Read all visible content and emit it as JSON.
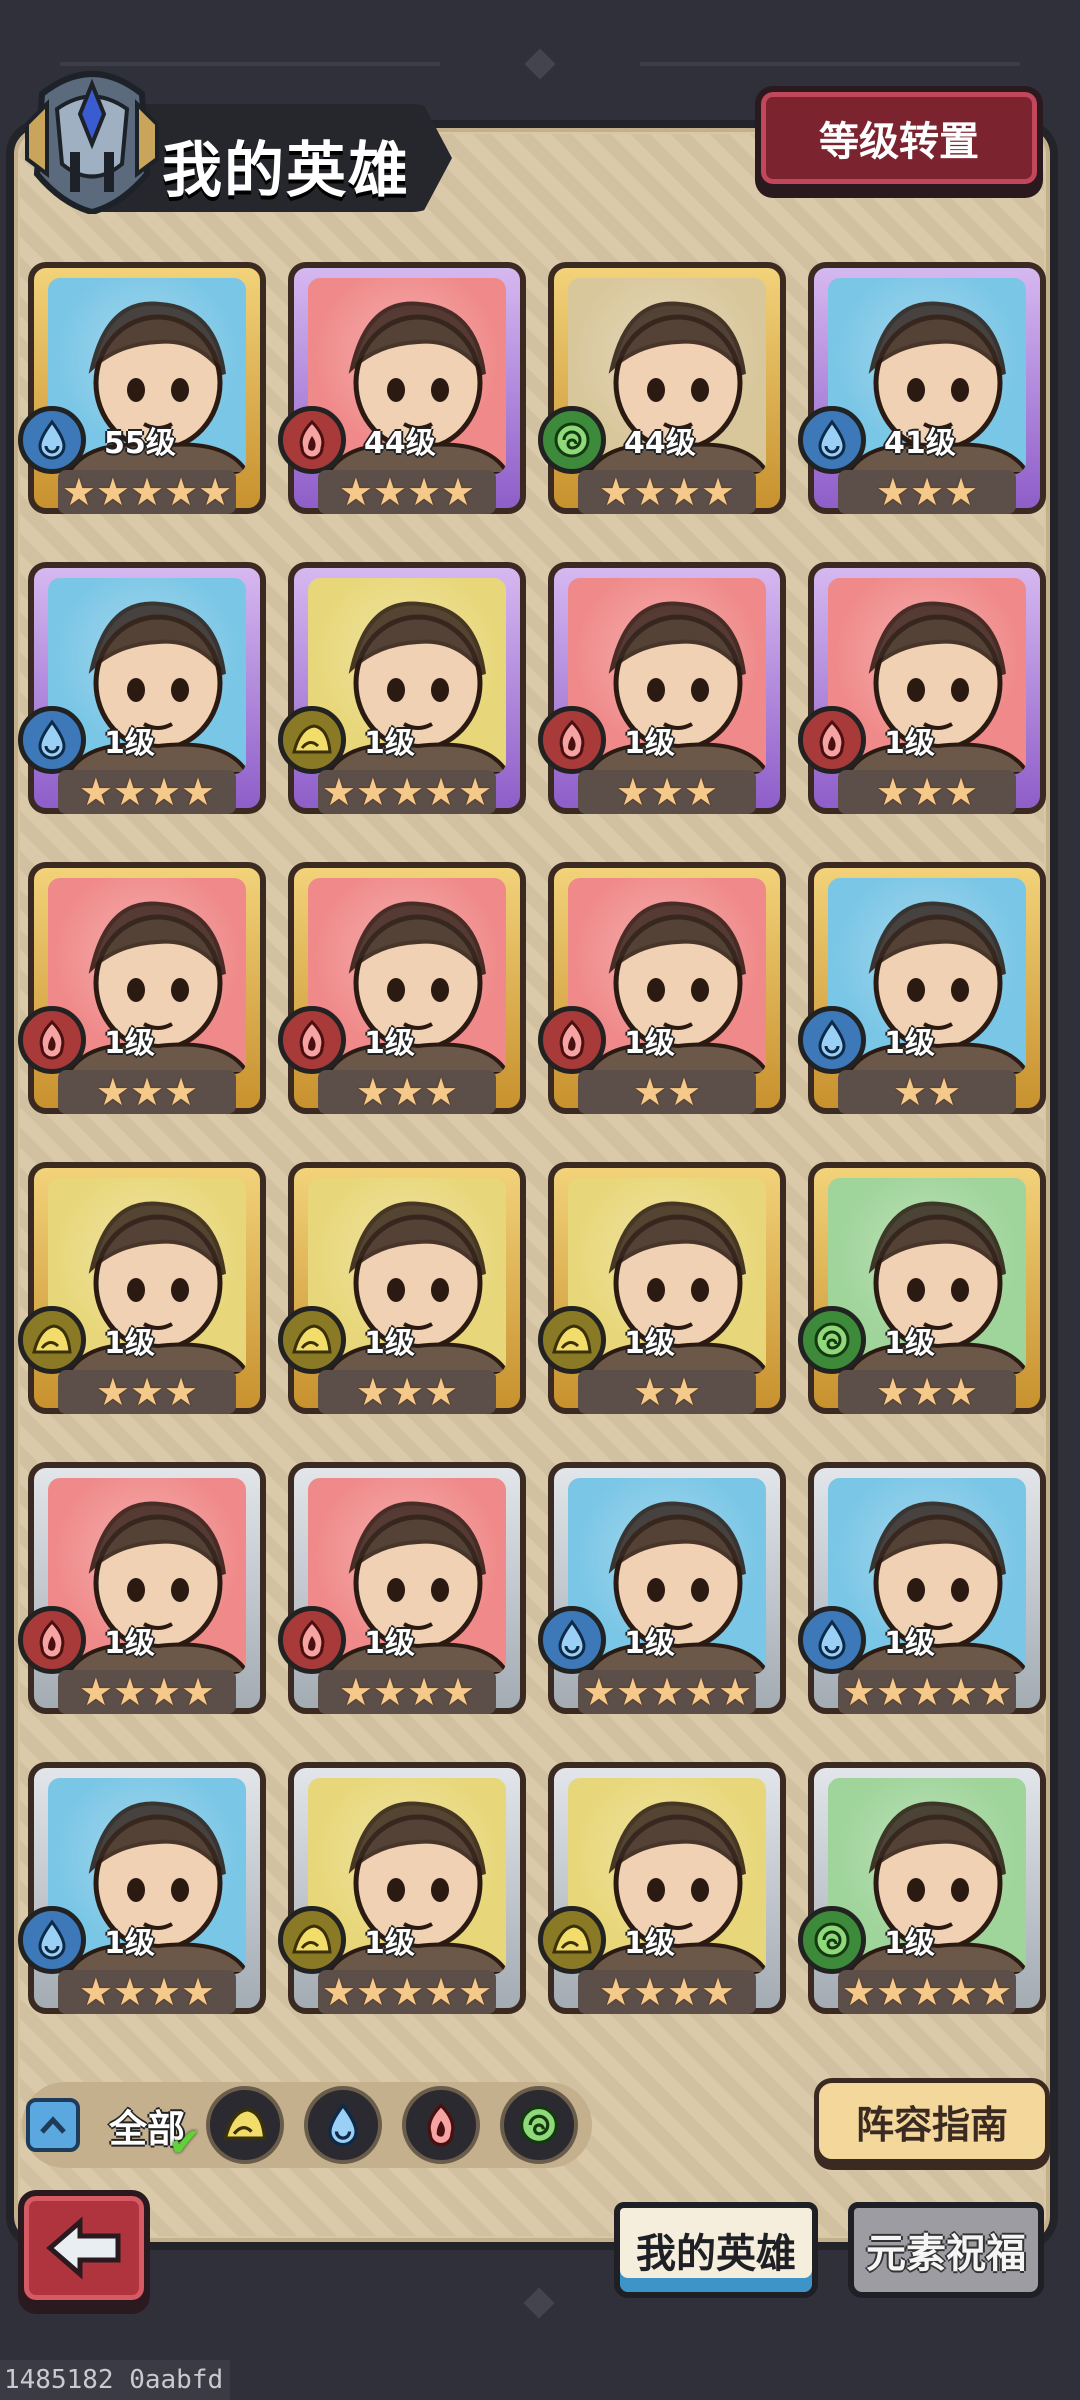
{
  "header": {
    "title": "我的英雄",
    "transfer_button": "等级转置"
  },
  "heroes": [
    {
      "level": "55级",
      "element": "water",
      "stars": "★★★★★",
      "frame": "gold",
      "bg": "#7ac6e6"
    },
    {
      "level": "44级",
      "element": "fire",
      "stars": "★★★★",
      "frame": "purple",
      "bg": "#f08a8a"
    },
    {
      "level": "44级",
      "element": "wind",
      "stars": "★★★★",
      "frame": "gold",
      "bg": "#d9c79c"
    },
    {
      "level": "41级",
      "element": "water",
      "stars": "★★★",
      "frame": "purple",
      "bg": "#7ac6e6"
    },
    {
      "level": "1级",
      "element": "water",
      "stars": "★★★★",
      "frame": "purple",
      "bg": "#7ac6e6"
    },
    {
      "level": "1级",
      "element": "earth",
      "stars": "★★★★★",
      "frame": "purple",
      "bg": "#e8d77a"
    },
    {
      "level": "1级",
      "element": "fire",
      "stars": "★★★",
      "frame": "purple",
      "bg": "#f08a8a"
    },
    {
      "level": "1级",
      "element": "fire",
      "stars": "★★★",
      "frame": "purple",
      "bg": "#f08a8a"
    },
    {
      "level": "1级",
      "element": "fire",
      "stars": "★★★",
      "frame": "gold",
      "bg": "#f08a8a"
    },
    {
      "level": "1级",
      "element": "fire",
      "stars": "★★★",
      "frame": "gold",
      "bg": "#f08a8a"
    },
    {
      "level": "1级",
      "element": "fire",
      "stars": "★★",
      "frame": "gold",
      "bg": "#f08a8a"
    },
    {
      "level": "1级",
      "element": "water",
      "stars": "★★",
      "frame": "gold",
      "bg": "#7ac6e6"
    },
    {
      "level": "1级",
      "element": "earth",
      "stars": "★★★",
      "frame": "gold",
      "bg": "#e8d77a"
    },
    {
      "level": "1级",
      "element": "earth",
      "stars": "★★★",
      "frame": "gold",
      "bg": "#e8d77a"
    },
    {
      "level": "1级",
      "element": "earth",
      "stars": "★★",
      "frame": "gold",
      "bg": "#e8d77a"
    },
    {
      "level": "1级",
      "element": "wind",
      "stars": "★★★",
      "frame": "gold",
      "bg": "#9fd49a"
    },
    {
      "level": "1级",
      "element": "fire",
      "stars": "★★★★",
      "frame": "silver",
      "bg": "#f08a8a"
    },
    {
      "level": "1级",
      "element": "fire",
      "stars": "★★★★",
      "frame": "silver",
      "bg": "#f08a8a"
    },
    {
      "level": "1级",
      "element": "water",
      "stars": "★★★★★",
      "frame": "silver",
      "bg": "#7ac6e6"
    },
    {
      "level": "1级",
      "element": "water",
      "stars": "★★★★★",
      "frame": "silver",
      "bg": "#7ac6e6"
    },
    {
      "level": "1级",
      "element": "water",
      "stars": "★★★★",
      "frame": "silver",
      "bg": "#7ac6e6"
    },
    {
      "level": "1级",
      "element": "earth",
      "stars": "★★★★★",
      "frame": "silver",
      "bg": "#e8d77a"
    },
    {
      "level": "1级",
      "element": "earth",
      "stars": "★★★★",
      "frame": "silver",
      "bg": "#e8d77a"
    },
    {
      "level": "1级",
      "element": "wind",
      "stars": "★★★★★",
      "frame": "silver",
      "bg": "#9fd49a"
    }
  ],
  "filters": {
    "all_label": "全部",
    "elements": [
      "earth",
      "water",
      "fire",
      "wind"
    ]
  },
  "guide_button": "阵容指南",
  "tabs": {
    "my_heroes": "我的英雄",
    "element_blessing": "元素祝福"
  },
  "footer_id": "1485182 0aabfd",
  "colors": {
    "water": "#3d78b8",
    "fire": "#a83a3a",
    "earth": "#8b7a25",
    "wind": "#3c8a3a"
  }
}
